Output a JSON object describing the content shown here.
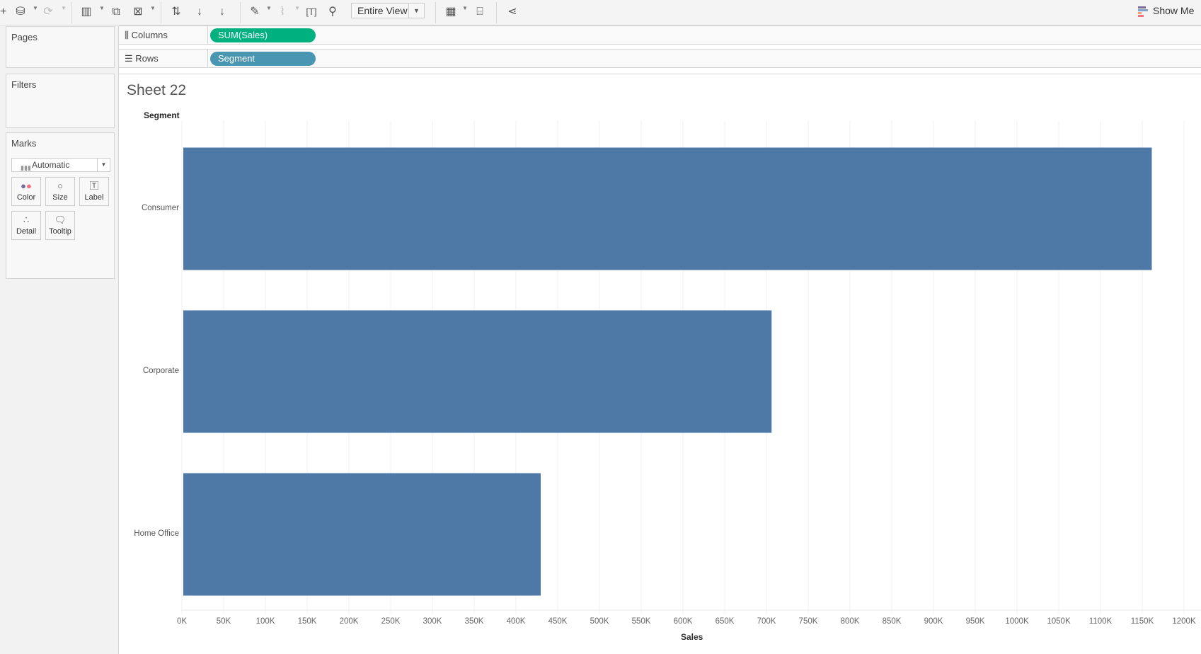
{
  "toolbar": {
    "view_mode": "Entire View",
    "show_me": "Show Me",
    "icons": [
      "datasource-icon",
      "refresh-icon",
      "new-worksheet-icon",
      "duplicate-sheet-icon",
      "clear-sheet-icon",
      "swap-icon",
      "sort-ascending-icon",
      "sort-descending-icon",
      "highlight-icon",
      "attach-icon",
      "text-icon",
      "pin-icon",
      "show-cards-icon",
      "presentation-icon",
      "share-icon"
    ]
  },
  "cards": {
    "pages": "Pages",
    "filters": "Filters",
    "marks": "Marks",
    "mark_type": "Automatic",
    "mark_buttons": [
      "Color",
      "Size",
      "Label",
      "Detail",
      "Tooltip"
    ]
  },
  "shelves": {
    "columns_label": "Columns",
    "columns_pill": "SUM(Sales)",
    "rows_label": "Rows",
    "rows_pill": "Segment"
  },
  "colors": {
    "measure_pill": "#00b180",
    "dimension_pill": "#4996b2",
    "bar": "#4e79a7"
  },
  "sheet": {
    "title": "Sheet 22"
  },
  "chart_data": {
    "type": "bar",
    "orientation": "horizontal",
    "title": "Sheet 22",
    "ylabel": "Segment",
    "xlabel": "Sales",
    "categories": [
      "Consumer",
      "Corporate",
      "Home Office"
    ],
    "values": [
      1161401,
      706146,
      429653
    ],
    "xlim": [
      0,
      1200000
    ],
    "ticks": [
      "0K",
      "50K",
      "100K",
      "150K",
      "200K",
      "250K",
      "300K",
      "350K",
      "400K",
      "450K",
      "500K",
      "550K",
      "600K",
      "650K",
      "700K",
      "750K",
      "800K",
      "850K",
      "900K",
      "950K",
      "1000K",
      "1050K",
      "1100K",
      "1150K",
      "1200K"
    ],
    "grid": true
  }
}
